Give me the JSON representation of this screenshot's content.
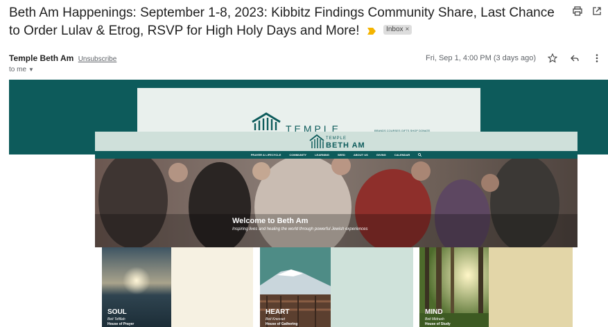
{
  "email": {
    "subject": "Beth Am Happenings: September 1-8, 2023: Kibbitz Findings Community Share, Last Chance to Order Lulav & Etrog, RSVP for High Holy Days and More!",
    "label": "Inbox",
    "sender": "Temple Beth Am",
    "unsubscribe": "Unsubscribe",
    "recipient": "to me",
    "date": "Fri, Sep 1, 4:00 PM (3 days ago)"
  },
  "newsletter": {
    "inner_logo_word": "TEMPLE",
    "inner_micro": "BRANDS  COURSES  GIFTS SHOP  DONATE",
    "site_logo_top": "TEMPLE",
    "site_logo_bottom": "BETH AM",
    "nav": [
      "PRAYER & LIFECYCLE",
      "COMMUNITY",
      "LEARNING",
      "SEED",
      "ABOUT US",
      "GIVING",
      "CALENDAR"
    ],
    "hero_title": "Welcome to Beth Am",
    "hero_sub": "Inspiring lives and healing the world through powerful Jewish experiences",
    "cards": [
      {
        "title": "SOUL",
        "sub1": "Beit Tefillah",
        "sub2": "House of Prayer"
      },
      {
        "title": "HEART",
        "sub1": "Beit Knesset",
        "sub2": "House of Gathering"
      },
      {
        "title": "MIND",
        "sub1": "Beit Midrash",
        "sub2": "House of Study"
      }
    ]
  },
  "colors": {
    "brand_teal": "#0d5b5b",
    "label_arrow": "#f4b400",
    "card_cream": "#f6f1e2",
    "card_mint": "#cfe2da",
    "card_tan": "#e3d6a8"
  },
  "icons": [
    "print-icon",
    "open-new-window-icon",
    "star-icon",
    "reply-icon",
    "more-vert-icon",
    "search-icon"
  ]
}
